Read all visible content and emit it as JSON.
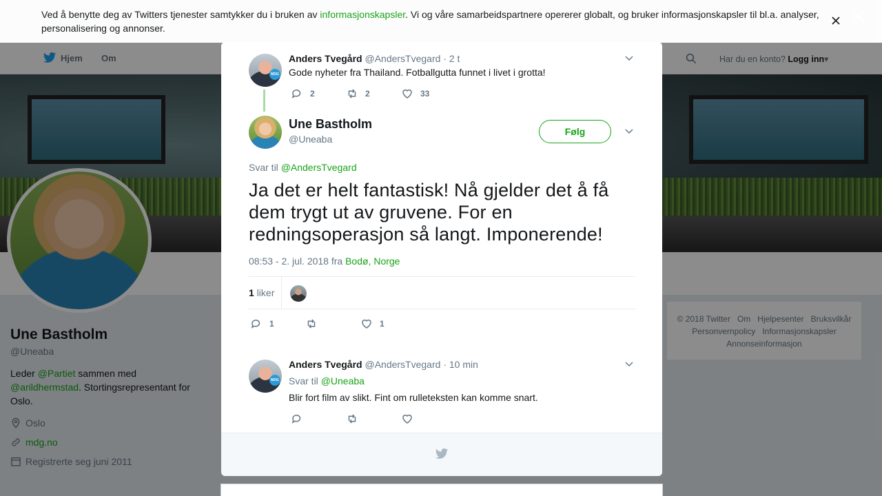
{
  "cookie_banner": {
    "text_before": "Ved å benytte deg av Twitters tjenester samtykker du i bruken av ",
    "link": "informasjonskapsler",
    "text_after": ". Vi og våre samarbeidspartnere opererer globalt, og bruker informasjonskapsler til bl.a. analyser, personalisering og annonser."
  },
  "nav": {
    "home": "Hjem",
    "about": "Om",
    "login_prompt": "Har du en konto?",
    "login": "Logg inn"
  },
  "profile": {
    "name": "Une Bastholm",
    "handle": "@Uneaba",
    "bio_1": "Leder ",
    "bio_mention_1": "@Partiet",
    "bio_2": " sammen med ",
    "bio_mention_2": "@arildhermstad",
    "bio_3": ". Stortingsrepresentant for Oslo.",
    "location": "Oslo",
    "url": "mdg.no",
    "joined": "Registrerte seg juni 2011"
  },
  "footer": {
    "items": [
      "© 2018 Twitter",
      "Om",
      "Hjelpesenter",
      "Bruksvilkår",
      "Personvernpolicy",
      "Informasjonskapsler",
      "Annonseinformasjon"
    ]
  },
  "modal": {
    "parent_tweet": {
      "name": "Anders Tvegård",
      "handle": "@AndersTvegard",
      "time": "· 2 t",
      "text": "Gode nyheter fra Thailand. Fotballgutta funnet i livet i grotta!",
      "replies": "2",
      "retweets": "2",
      "likes": "33"
    },
    "main_tweet": {
      "name": "Une Bastholm",
      "handle": "@Uneaba",
      "follow": "Følg",
      "reply_to_label": "Svar til ",
      "reply_to": "@AndersTvegard",
      "text": "Ja det er helt fantastisk! Nå gjelder det å få dem trygt ut av gruvene. For en redningsoperasjon så langt. Imponerende!",
      "timestamp": "08:53 - 2. jul. 2018 fra ",
      "location": "Bodø, Norge",
      "like_count": "1",
      "like_label": " liker",
      "replies": "1",
      "retweets": "",
      "likes": "1"
    },
    "reply_tweet": {
      "name": "Anders Tvegård",
      "handle": "@AndersTvegard",
      "time": "· 10 min",
      "reply_to_label": "Svar til ",
      "reply_to": "@Uneaba",
      "text": "Blir fort film av slikt. Fint om rulleteksten kan komme snart."
    }
  },
  "colors": {
    "accent": "#17a317",
    "muted": "#657786",
    "text": "#14171a"
  }
}
